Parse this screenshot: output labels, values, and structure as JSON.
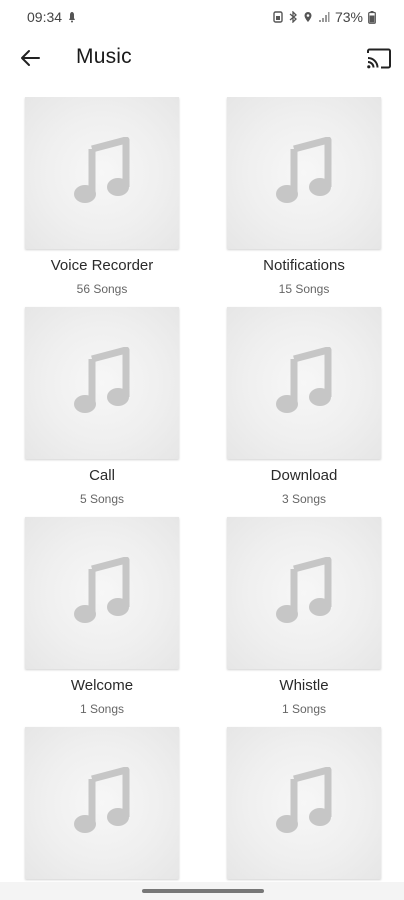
{
  "status": {
    "time": "09:34",
    "battery": "73%"
  },
  "app_bar": {
    "title": "Music"
  },
  "icons": {
    "back": "arrow-back-icon",
    "cast": "cast-icon",
    "note": "music-note-icon"
  },
  "playlists": [
    {
      "name": "Voice Recorder",
      "count": "56 Songs"
    },
    {
      "name": "Notifications",
      "count": "15 Songs"
    },
    {
      "name": "Call",
      "count": "5 Songs"
    },
    {
      "name": "Download",
      "count": "3 Songs"
    },
    {
      "name": "Welcome",
      "count": "1 Songs"
    },
    {
      "name": "Whistle",
      "count": "1 Songs"
    },
    {
      "name": "",
      "count": ""
    },
    {
      "name": "",
      "count": ""
    }
  ]
}
